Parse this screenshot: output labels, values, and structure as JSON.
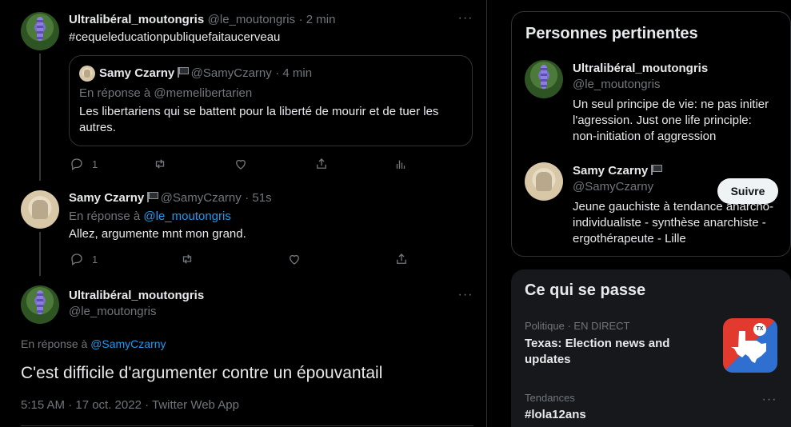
{
  "tweet1": {
    "name": "Ultralibéral_moutongris",
    "handle": "@le_moutongris",
    "time": "· 2 min",
    "hashtag": "#cequeleducationpubliquefaitaucerveau",
    "quote": {
      "name": "Samy Czarny",
      "handle": "@SamyCzarny",
      "time": "· 4 min",
      "reply_to": "En réponse à @memelibertarien",
      "text_line1": "Les libertariens qui se battent pour la liberté de mourir et de tuer les",
      "text_line2": "autres."
    },
    "reply_count": "1"
  },
  "tweet2": {
    "name": "Samy Czarny",
    "handle": "@SamyCzarny",
    "time": "· 51s",
    "reply_prefix": "En réponse à",
    "reply_handle": "@le_moutongris",
    "text": "Allez, argumente mnt mon grand.",
    "reply_count": "1"
  },
  "main_tweet": {
    "name": "Ultralibéral_moutongris",
    "handle": "@le_moutongris",
    "reply_prefix": "En réponse à",
    "reply_handle": "@SamyCzarny",
    "text": "C'est difficile d'argumenter contre un épouvantail",
    "meta": "5:15 AM · 17 oct. 2022 · Twitter Web App"
  },
  "people": {
    "title": "Personnes pertinentes",
    "p1": {
      "name": "Ultralibéral_moutongris",
      "handle": "@le_moutongris",
      "bio_line1": "Un seul principe de vie: ne pas initier",
      "bio_line2": "l'agression. Just one life principle:",
      "bio_line3": "non-initiation of aggression"
    },
    "p2": {
      "name": "Samy Czarny",
      "handle": "@SamyCzarny",
      "follow_label": "Suivre",
      "bio_line1": "Jeune gauchiste à tendance anarcho-",
      "bio_line2": "individualiste - synthèse anarchiste -",
      "bio_line3": "ergothérapeute - Lille"
    }
  },
  "trends": {
    "title": "Ce qui se passe",
    "t1": {
      "category": "Politique · EN DIRECT",
      "title_line1": "Texas: Election news and",
      "title_line2": "updates",
      "badge": "TX"
    },
    "t2": {
      "category": "Tendances",
      "title": "#lola12ans"
    }
  }
}
